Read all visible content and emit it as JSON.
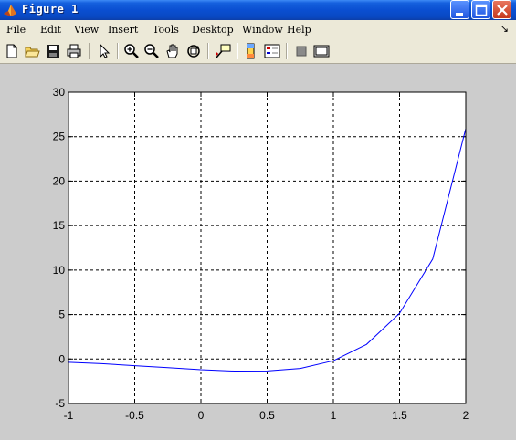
{
  "window": {
    "title": "Figure 1",
    "controls": {
      "minimize": "minimize",
      "maximize": "maximize",
      "close": "close"
    }
  },
  "menubar": {
    "items": [
      {
        "label": "File"
      },
      {
        "label": "Edit"
      },
      {
        "label": "View"
      },
      {
        "label": "Insert"
      },
      {
        "label": "Tools"
      },
      {
        "label": "Desktop"
      },
      {
        "label": "Window"
      },
      {
        "label": "Help"
      }
    ],
    "overflow_glyph": "↘"
  },
  "toolbar": {
    "icons": [
      "new-figure-icon",
      "open-file-icon",
      "save-icon",
      "print-icon",
      "edit-plot-icon",
      "zoom-in-icon",
      "zoom-out-icon",
      "pan-icon",
      "rotate-3d-icon",
      "data-cursor-icon",
      "insert-colorbar-icon",
      "insert-legend-icon",
      "hide-plot-tools-icon",
      "show-plot-tools-icon"
    ]
  },
  "chart_data": {
    "type": "line",
    "title": "",
    "xlabel": "",
    "ylabel": "",
    "xlim": [
      -1,
      2
    ],
    "ylim": [
      -5,
      30
    ],
    "grid": true,
    "grid_style": "dashed",
    "line_color": "#0000ff",
    "x_ticks": [
      "-1",
      "-0.5",
      "0",
      "0.5",
      "1",
      "1.5",
      "2"
    ],
    "y_ticks": [
      "-5",
      "0",
      "5",
      "10",
      "15",
      "20",
      "25",
      "30"
    ],
    "series": [
      {
        "x": [
          -1,
          -0.75,
          -0.5,
          -0.25,
          0,
          0.25,
          0.5,
          0.75,
          1,
          1.25,
          1.5,
          1.75,
          2
        ],
        "values": [
          -0.37,
          -0.53,
          -0.75,
          -0.97,
          -1.2,
          -1.36,
          -1.35,
          -1.06,
          -0.2,
          1.64,
          5.14,
          11.24,
          25.9
        ]
      }
    ]
  }
}
